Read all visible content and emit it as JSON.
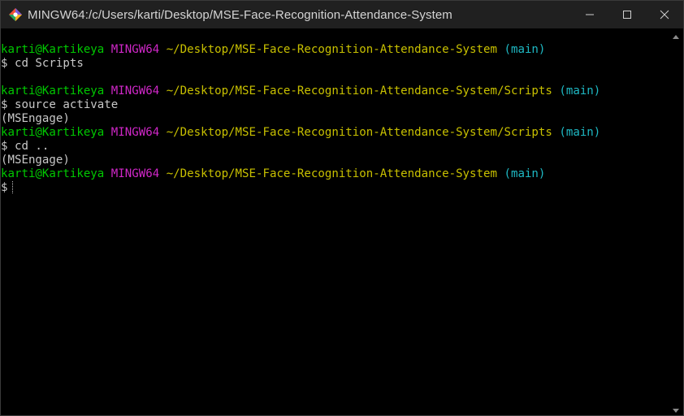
{
  "window": {
    "title": "MINGW64:/c/Users/karti/Desktop/MSE-Face-Recognition-Attendance-System",
    "app_icon": "git-bash-icon",
    "controls": [
      "minimize-icon",
      "maximize-icon",
      "close-icon"
    ]
  },
  "colors": {
    "background": "#000000",
    "titlebar": "#202020",
    "user": "#00c800",
    "env": "#d027c8",
    "path": "#c8c000",
    "branch": "#1eb9c4",
    "text": "#c8c8c8"
  },
  "terminal": {
    "blocks": [
      {
        "prompt": {
          "user": "karti@Kartikeya",
          "env": "MINGW64",
          "path": "~/Desktop/MSE-Face-Recognition-Attendance-System",
          "branch": "(main)"
        },
        "command": "$ cd Scripts"
      },
      {
        "prompt": {
          "user": "karti@Kartikeya",
          "env": "MINGW64",
          "path": "~/Desktop/MSE-Face-Recognition-Attendance-System/Scripts",
          "branch": "(main)"
        },
        "command": "$ source activate"
      },
      {
        "venv": "(MSEngage)",
        "prompt": {
          "user": "karti@Kartikeya",
          "env": "MINGW64",
          "path": "~/Desktop/MSE-Face-Recognition-Attendance-System/Scripts",
          "branch": "(main)"
        },
        "command": "$ cd .."
      },
      {
        "venv": "(MSEngage)",
        "prompt": {
          "user": "karti@Kartikeya",
          "env": "MINGW64",
          "path": "~/Desktop/MSE-Face-Recognition-Attendance-System",
          "branch": "(main)"
        },
        "command": "$"
      }
    ]
  }
}
